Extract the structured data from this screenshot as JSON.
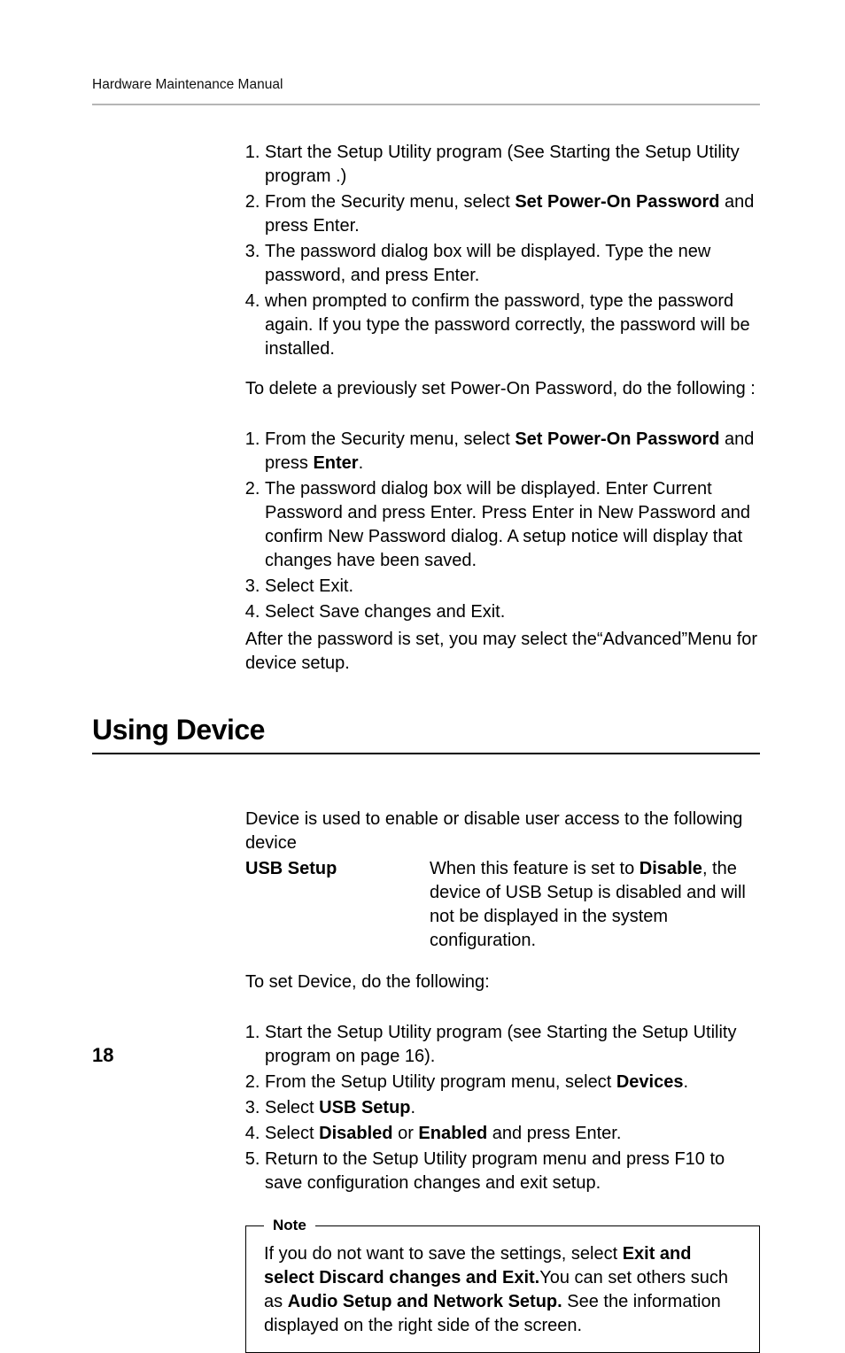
{
  "header": {
    "running_title": "Hardware Maintenance Manual"
  },
  "set_pwd_steps": [
    {
      "pre": "Start the Setup Utility program (See  Starting the Setup Utility program .)"
    },
    {
      "pre": "From the Security menu, select ",
      "b1": "Set Power-On Password",
      "post1": " and press Enter."
    },
    {
      "pre": "The password dialog box will be displayed. Type the new password, and press Enter."
    },
    {
      "pre": "when prompted to confirm the password, type the password again. If you type the password correctly, the password will be installed."
    }
  ],
  "delete_intro": "To delete a previously set Power-On Password, do the following :",
  "delete_steps": [
    {
      "pre": "From the Security menu, select ",
      "b1": "Set Power-On Password",
      "post1": " and  press ",
      "b2": "Enter",
      "post2": "."
    },
    {
      "pre": "The password dialog box will be displayed. Enter Current Password and press Enter. Press Enter in New Password and confirm New Password dialog. A setup notice will display that changes have been saved."
    },
    {
      "pre": "Select Exit."
    },
    {
      "pre": "Select Save changes and Exit."
    }
  ],
  "after_pwd": "After the password is set, you may select the“Advanced”Menu for device setup.",
  "section_title": "Using Device",
  "device_intro": "Device is used to enable or disable user access to the following device",
  "usb_term": "USB Setup",
  "usb_def_pre": "When this feature is set to ",
  "usb_def_b": "Disable",
  "usb_def_post": ", the device of USB Setup is disabled and  will not  be displayed in the system configuration.",
  "set_device_intro": "To set Device, do the following:",
  "device_steps": [
    {
      "pre": "Start the Setup Utility program (see  Starting the Setup Utility program on page 16)."
    },
    {
      "pre": "From the Setup Utility program menu, select ",
      "b1": "Devices",
      "post1": "."
    },
    {
      "pre": "Select ",
      "b1": "USB Setup",
      "post1": "."
    },
    {
      "pre": "Select ",
      "b1": "Disabled",
      "post1": " or ",
      "b2": "Enabled",
      "post2": " and press Enter."
    },
    {
      "pre": "Return to the Setup Utility program menu and press F10 to save configuration changes and exit setup."
    }
  ],
  "note": {
    "label": "Note",
    "pre": "If you do not want to save the settings, select ",
    "b1": "Exit and select Discard changes and Exit.",
    "mid": "You can set others such as ",
    "b2": "Audio Setup and Network Setup.",
    "post": " See the information displayed on the right side of the screen."
  },
  "page_number": "18"
}
